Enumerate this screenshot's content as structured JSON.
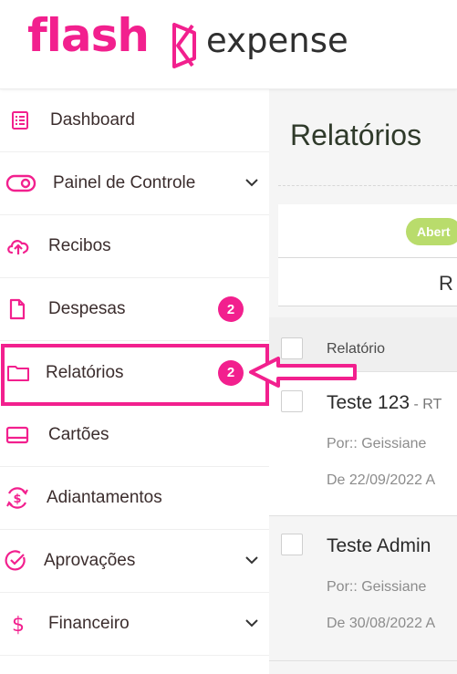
{
  "brand": {
    "name_part1": "flash",
    "name_part2": "expense",
    "accent_color": "#f2208e"
  },
  "sidebar": {
    "items": [
      {
        "label": "Dashboard",
        "icon": "dashboard-list-icon"
      },
      {
        "label": "Painel de Controle",
        "icon": "toggle-icon",
        "expandable": true
      },
      {
        "label": "Recibos",
        "icon": "cloud-upload-icon"
      },
      {
        "label": "Despesas",
        "icon": "document-icon",
        "badge": "2"
      },
      {
        "label": "Relatórios",
        "icon": "folder-icon",
        "badge": "2",
        "highlighted": true
      },
      {
        "label": "Cartões",
        "icon": "card-icon"
      },
      {
        "label": "Adiantamentos",
        "icon": "refresh-dollar-icon"
      },
      {
        "label": "Aprovações",
        "icon": "check-circle-icon",
        "expandable": true
      },
      {
        "label": "Financeiro",
        "icon": "dollar-icon",
        "expandable": true
      }
    ]
  },
  "main": {
    "title": "Relatórios",
    "status_filter": "Abert",
    "tab_letter": "R",
    "table": {
      "header": "Relatório",
      "rows": [
        {
          "title": "Teste 123",
          "suffix": " - RT",
          "author": "Por:: Geissiane",
          "date": "De 22/09/2022 A"
        },
        {
          "title": "Teste Admin",
          "suffix": "",
          "author": "Por:: Geissiane",
          "date": "De 30/08/2022 A"
        }
      ]
    }
  }
}
